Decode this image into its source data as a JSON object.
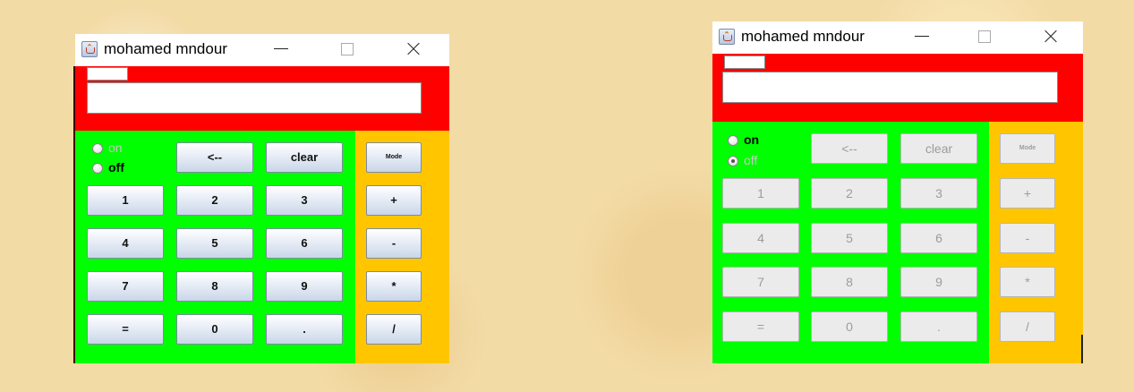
{
  "windows": [
    {
      "title": "mohamed mndour",
      "state": "on-enabled",
      "radio_on": {
        "label": "on",
        "checked": false,
        "disabled": true
      },
      "radio_off": {
        "label": "off",
        "checked": true,
        "disabled": false
      },
      "buttons_enabled": true
    },
    {
      "title": "mohamed mndour",
      "state": "off-disabled",
      "radio_on": {
        "label": "on",
        "checked": false,
        "disabled": false
      },
      "radio_off": {
        "label": "off",
        "checked": true,
        "disabled": true
      },
      "buttons_enabled": false
    }
  ],
  "keys": {
    "backspace": "<--",
    "clear": "clear",
    "mode": "Mode",
    "digits": [
      "1",
      "2",
      "3",
      "4",
      "5",
      "6",
      "7",
      "8",
      "9",
      "0"
    ],
    "equals": "=",
    "dot": ".",
    "plus": "+",
    "minus": "-",
    "multiply": "*",
    "divide": "/"
  },
  "colors": {
    "top_panel": "#ff0000",
    "keypad_panel": "#00ff00",
    "operator_panel": "#ffc600"
  }
}
